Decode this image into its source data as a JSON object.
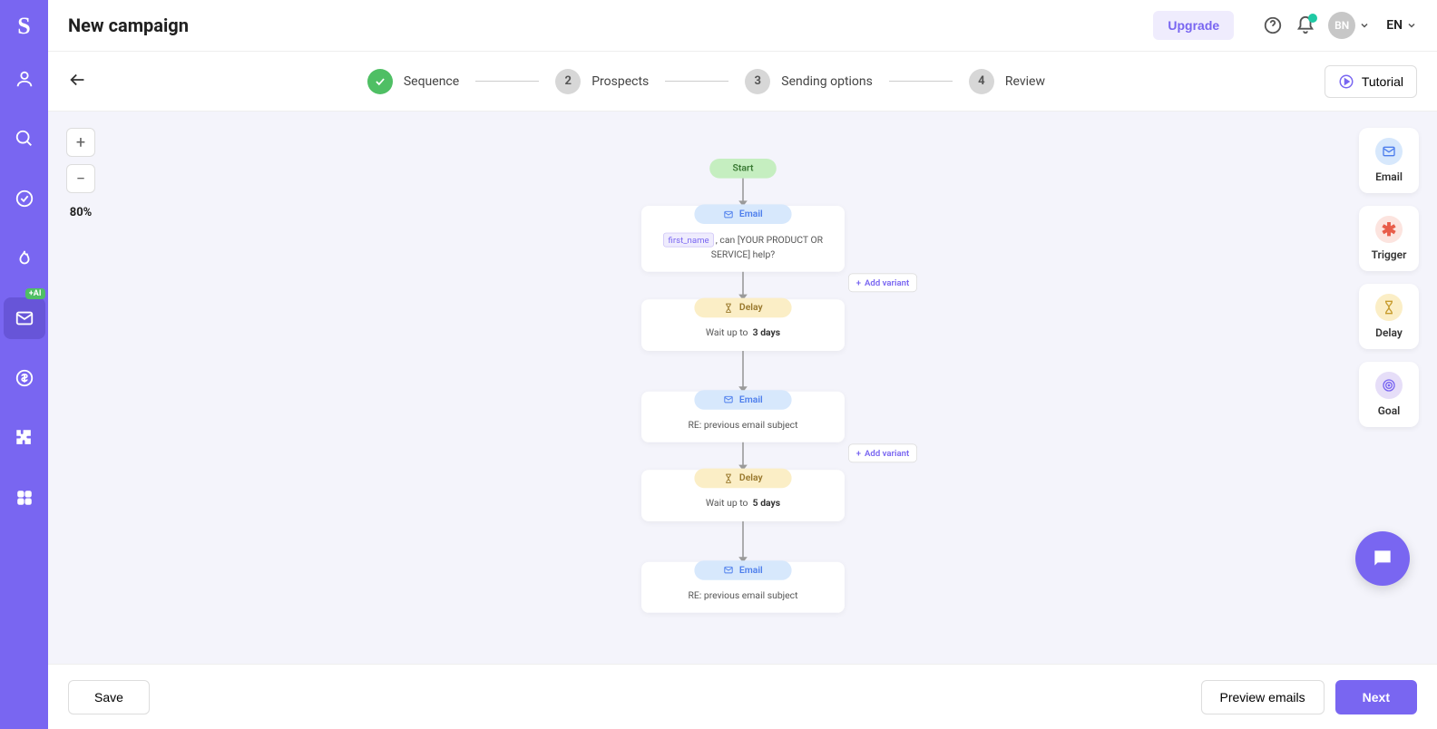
{
  "header": {
    "title": "New campaign",
    "upgrade": "Upgrade",
    "avatar_initials": "BN",
    "language": "EN"
  },
  "steps": {
    "items": [
      {
        "label": "Sequence",
        "done": true
      },
      {
        "label": "Prospects",
        "num": "2"
      },
      {
        "label": "Sending options",
        "num": "3"
      },
      {
        "label": "Review",
        "num": "4"
      }
    ],
    "tutorial": "Tutorial"
  },
  "zoom": {
    "level": "80%"
  },
  "palette": {
    "email": "Email",
    "trigger": "Trigger",
    "delay": "Delay",
    "goal": "Goal"
  },
  "flow": {
    "start": "Start",
    "email_label": "Email",
    "delay_label": "Delay",
    "add_variant": "Add variant",
    "wait_up_to": "Wait up to",
    "node1": {
      "variable": "first_name",
      "text_after": ", can [YOUR PRODUCT OR SERVICE] help?"
    },
    "node2": {
      "duration": "3 days"
    },
    "node3": {
      "subject": "RE: previous email subject"
    },
    "node4": {
      "duration": "5 days"
    },
    "node5": {
      "subject": "RE: previous email subject"
    }
  },
  "footer": {
    "save": "Save",
    "preview": "Preview emails",
    "next": "Next"
  },
  "sidebar": {
    "ai_badge": "+AI"
  }
}
